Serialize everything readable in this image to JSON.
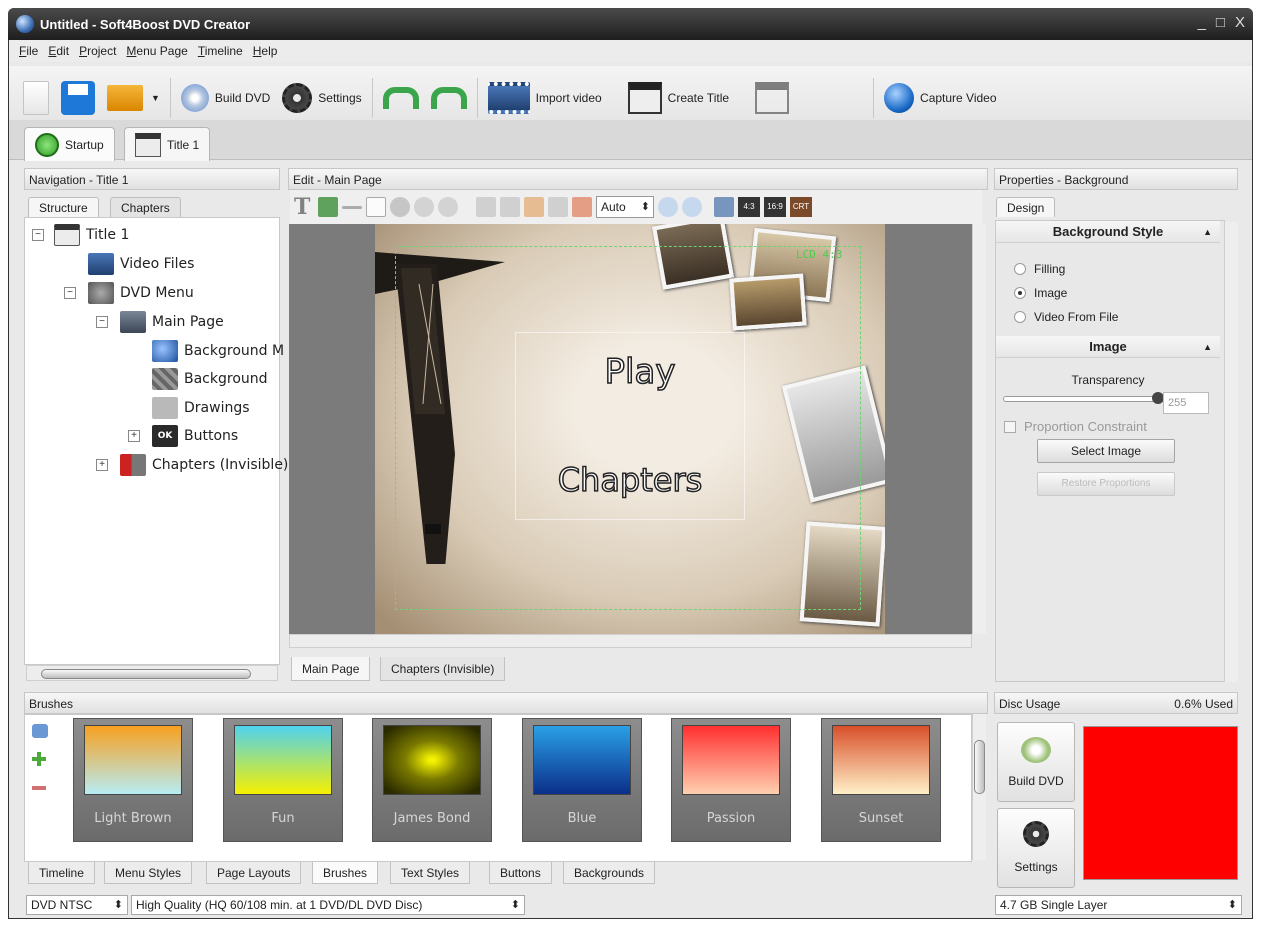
{
  "window": {
    "title": "Untitled - Soft4Boost DVD Creator",
    "controls": [
      "_",
      "□",
      "X"
    ]
  },
  "menu": [
    "File",
    "Edit",
    "Project",
    "Menu Page",
    "Timeline",
    "Help"
  ],
  "toolbar": {
    "build_dvd": "Build DVD",
    "settings": "Settings",
    "import_video": "Import video",
    "create_title": "Create Title",
    "capture_video": "Capture Video"
  },
  "doc_tabs": {
    "startup": "Startup",
    "title1": "Title 1"
  },
  "navigation": {
    "header": "Navigation - Title 1",
    "tab_structure": "Structure",
    "tab_chapters": "Chapters",
    "tree": {
      "title1": "Title 1",
      "video_files": "Video Files",
      "dvd_menu": "DVD Menu",
      "main_page": "Main Page",
      "background_m": "Background M",
      "background": "Background",
      "drawings": "Drawings",
      "buttons": "Buttons",
      "chapters_invisible": "Chapters (Invisible)"
    }
  },
  "edit": {
    "header": "Edit - Main Page",
    "zoom": "Auto",
    "ratio_43": "4:3",
    "ratio_169": "16:9",
    "ratio_crt": "CRT",
    "safe_label": "LCD 4:3",
    "menu_play": "Play",
    "menu_chapters": "Chapters",
    "page_tabs": {
      "main": "Main Page",
      "chapters": "Chapters (Invisible)"
    }
  },
  "properties": {
    "header": "Properties - Background",
    "tab_design": "Design",
    "bg_style_title": "Background Style",
    "options": {
      "filling": "Filling",
      "image": "Image",
      "video": "Video From File"
    },
    "image_title": "Image",
    "transparency_label": "Transparency",
    "transparency_value": "255",
    "proportion": "Proportion Constraint",
    "select_image": "Select Image",
    "restore_proportions": "Restore Proportions"
  },
  "brushes": {
    "header": "Brushes",
    "items": [
      {
        "name": "Light Brown",
        "gradient": "linear-gradient(#f7a020, #b7ecf3)"
      },
      {
        "name": "Fun",
        "gradient": "linear-gradient(#4fd2ef, #f6f000)"
      },
      {
        "name": "James Bond",
        "gradient": "radial-gradient(ellipse, #f2f000 5%, #7a7a00 40%, #2a2a00 90%)"
      },
      {
        "name": "Blue",
        "gradient": "linear-gradient(#2aa0e6, #0b2f8a)"
      },
      {
        "name": "Passion",
        "gradient": "linear-gradient(#ff3030, #ffd0b0)"
      },
      {
        "name": "Sunset",
        "gradient": "linear-gradient(#d8502a, #fff0c8)"
      }
    ]
  },
  "bottom_tabs": {
    "timeline": "Timeline",
    "menu_styles": "Menu Styles",
    "page_layouts": "Page Layouts",
    "brushes": "Brushes",
    "text_styles": "Text Styles",
    "buttons": "Buttons",
    "backgrounds": "Backgrounds"
  },
  "disc": {
    "header": "Disc Usage",
    "used": "0.6% Used",
    "build_dvd": "Build DVD",
    "settings": "Settings",
    "bar_color": "#ff0000"
  },
  "status": {
    "format": "DVD NTSC",
    "quality": "High Quality (HQ 60/108 min. at 1 DVD/DL DVD Disc)",
    "disc_type": "4.7 GB Single Layer"
  }
}
